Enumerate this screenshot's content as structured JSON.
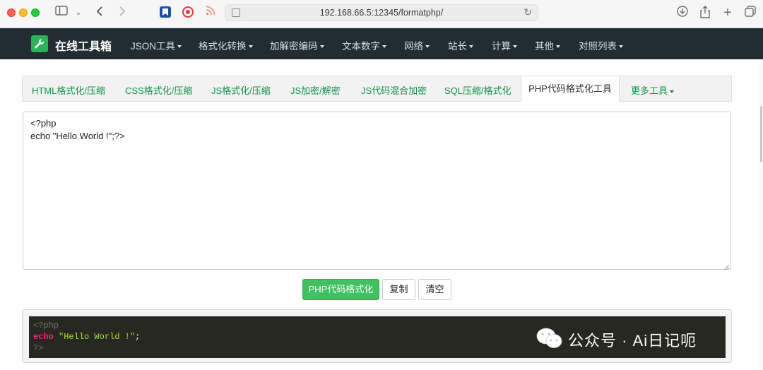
{
  "browser": {
    "url": "192.168.66.5:12345/formatphp/"
  },
  "navbar": {
    "brand": "在线工具箱",
    "items": [
      {
        "label": "JSON工具"
      },
      {
        "label": "格式化转换"
      },
      {
        "label": "加解密编码"
      },
      {
        "label": "文本数字"
      },
      {
        "label": "网络"
      },
      {
        "label": "站长"
      },
      {
        "label": "计算"
      },
      {
        "label": "其他"
      },
      {
        "label": "对照列表"
      }
    ]
  },
  "tabs": {
    "items": [
      {
        "label": "HTML格式化/压缩"
      },
      {
        "label": "CSS格式化/压缩"
      },
      {
        "label": "JS格式化/压缩"
      },
      {
        "label": "JS加密/解密"
      },
      {
        "label": "JS代码混合加密"
      },
      {
        "label": "SQL压缩/格式化"
      },
      {
        "label": "PHP代码格式化工具"
      },
      {
        "label": "更多工具"
      }
    ],
    "active_index": 6
  },
  "editor": {
    "value": "<?php\necho \"Hello World !\";?>"
  },
  "buttons": {
    "format": "PHP代码格式化",
    "copy": "复制",
    "clear": "清空"
  },
  "output": {
    "line1": "<?php",
    "line2_keyword": "echo",
    "line2_string": "\"Hello World !\"",
    "line2_end": ";",
    "line3": "?>"
  },
  "watermark": {
    "text": "公众号 · Ai日记呃"
  },
  "colors": {
    "navbar_bg": "#222c33",
    "accent_green": "#3fc061",
    "tab_link": "#178f4a",
    "code_bg": "#272822"
  }
}
